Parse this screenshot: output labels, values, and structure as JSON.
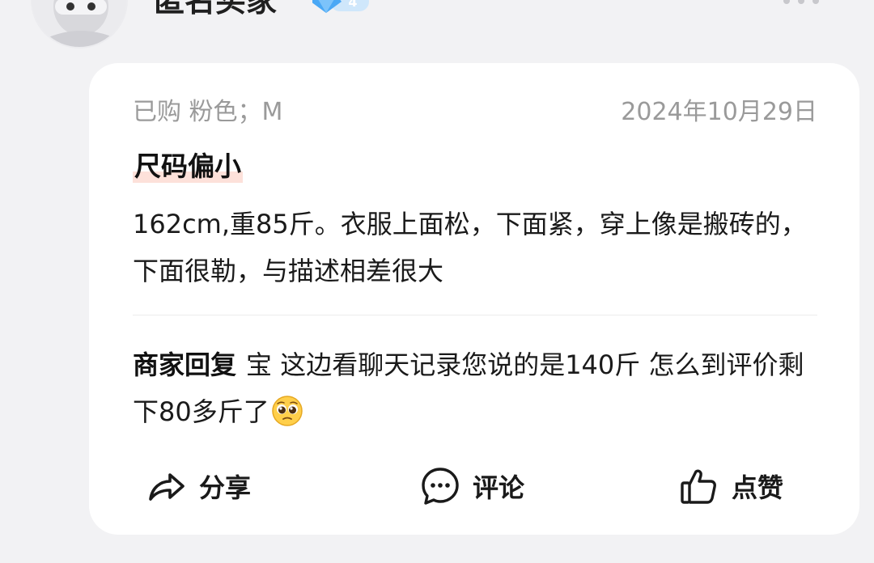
{
  "user": {
    "name": "匿名买家",
    "level": "4"
  },
  "review": {
    "purchase_info": "已购 粉色；M",
    "date": "2024年10月29日",
    "size_tag": "尺码偏小",
    "text": "162cm,重85斤。衣服上面松，下面紧，穿上像是搬砖的，下面很勒，与描述相差很大"
  },
  "merchant_reply": {
    "label": "商家回复",
    "text": "宝 这边看聊天记录您说的是140斤 怎么到评价剩下80多斤了",
    "emoji": "pleading-face-emoji"
  },
  "actions": {
    "share": {
      "label": "分享",
      "icon": "share-arrow-icon"
    },
    "comment": {
      "label": "评论",
      "icon": "comment-bubble-icon"
    },
    "like": {
      "label": "点赞",
      "icon": "thumbs-up-icon"
    }
  },
  "colors": {
    "background": "#f2f2f4",
    "card": "#ffffff",
    "muted_text": "#9a9a9a",
    "tag_highlight": "#fde1da",
    "level_badge": "#4aa8f5"
  }
}
